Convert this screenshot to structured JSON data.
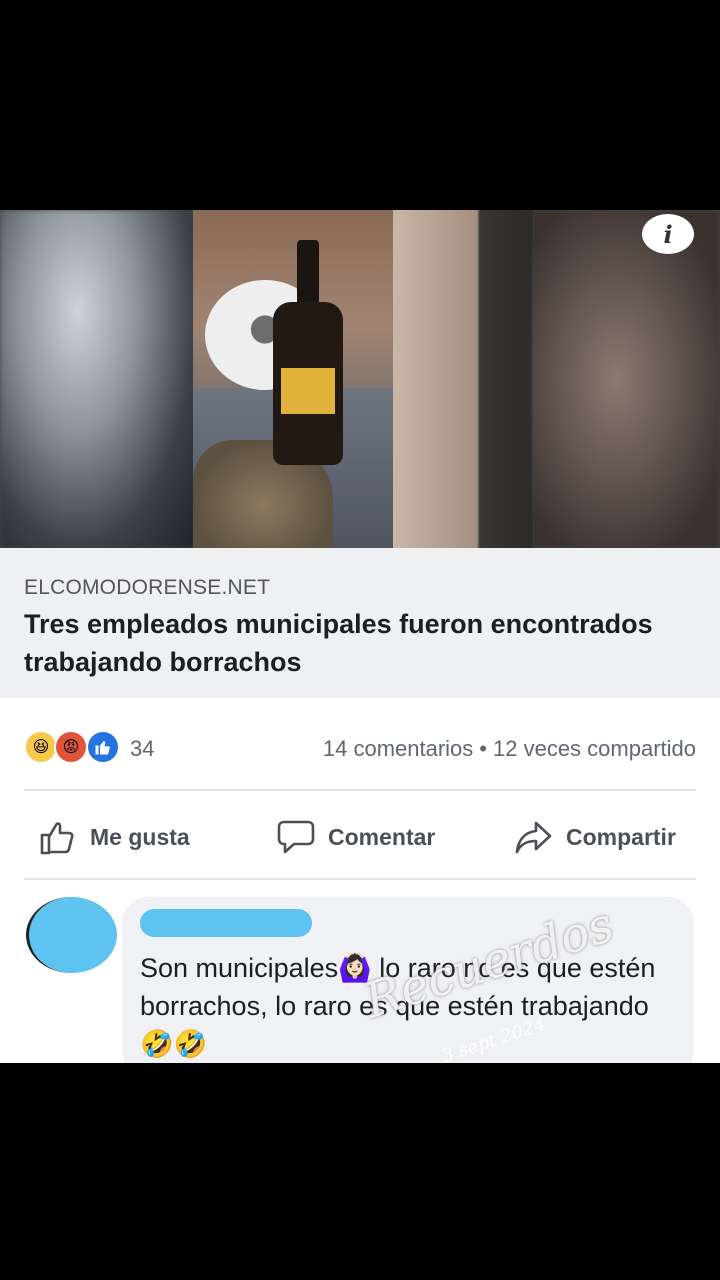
{
  "post": {
    "link": {
      "domain": "ELCOMODORENSE.NET",
      "title": "Tres empleados municipales fueron encontrados trabajando borrachos"
    },
    "stats": {
      "reaction_count": "34",
      "comments": "14 comentarios",
      "separator": "•",
      "shares": "12 veces compartido"
    },
    "actions": {
      "like": "Me gusta",
      "comment": "Comentar",
      "share": "Compartir"
    }
  },
  "comment": {
    "text": "Son municipales🙆🏻‍♀️ lo raro no es que estén borrachos, lo raro es que estén trabajando 🤣🤣"
  },
  "watermark": {
    "text": "Recuerdos",
    "date": "3 sept 2024"
  },
  "icons": {
    "info": "info-icon",
    "like": "thumbs-up-icon",
    "comment": "speech-bubble-icon",
    "share": "share-arrow-icon",
    "reactions": [
      "haha-icon",
      "angry-icon",
      "like-icon"
    ]
  },
  "colors": {
    "like_blue": "#2374e1",
    "censor_blue": "#5ec3f0",
    "link_bg": "#eef0f4"
  }
}
